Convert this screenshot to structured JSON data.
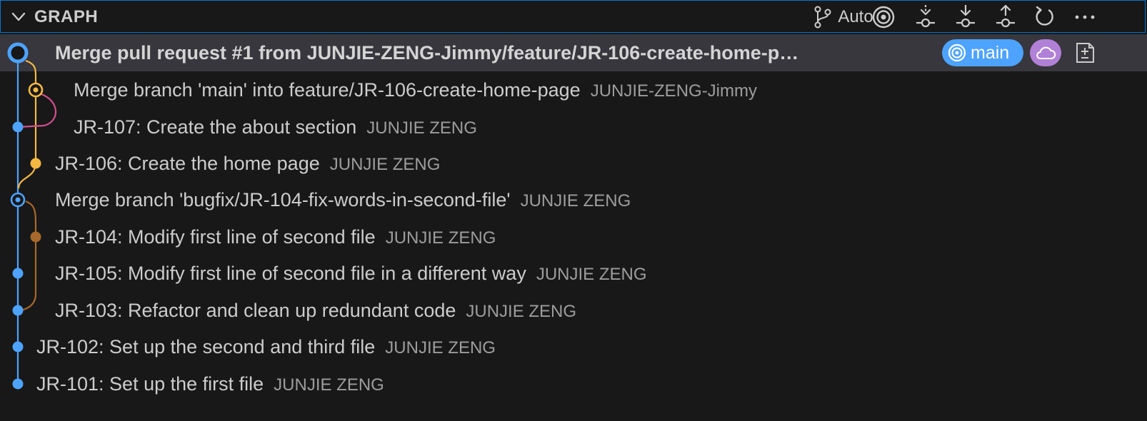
{
  "header": {
    "title": "GRAPH",
    "auto_label": "Auto"
  },
  "commits": [
    {
      "message": "Merge pull request #1 from JUNJIE-ZENG-Jimmy/feature/JR-106-create-home-p…",
      "author": ""
    },
    {
      "message": "Merge branch 'main' into feature/JR-106-create-home-page",
      "author": "JUNJIE-ZENG-Jimmy"
    },
    {
      "message": "JR-107: Create the about section",
      "author": "JUNJIE ZENG"
    },
    {
      "message": "JR-106: Create the home page",
      "author": "JUNJIE ZENG"
    },
    {
      "message": "Merge branch 'bugfix/JR-104-fix-words-in-second-file'",
      "author": "JUNJIE ZENG"
    },
    {
      "message": "JR-104: Modify first line of second file",
      "author": "JUNJIE ZENG"
    },
    {
      "message": "JR-105: Modify first line of second file in a different way",
      "author": "JUNJIE ZENG"
    },
    {
      "message": "JR-103: Refactor and clean up redundant code",
      "author": "JUNJIE ZENG"
    },
    {
      "message": "JR-102: Set up the second and third file",
      "author": "JUNJIE ZENG"
    },
    {
      "message": "JR-101: Set up the first file",
      "author": "JUNJIE ZENG"
    }
  ],
  "badges": {
    "branch_label": "main"
  },
  "colors": {
    "accent": "#0078d4",
    "lane_blue": "#4da3ff",
    "lane_yellow": "#f4b942",
    "lane_pink": "#d04f8e",
    "lane_brown": "#a8692a",
    "badge_cloud": "#b180d7",
    "selection": "#37373d"
  }
}
